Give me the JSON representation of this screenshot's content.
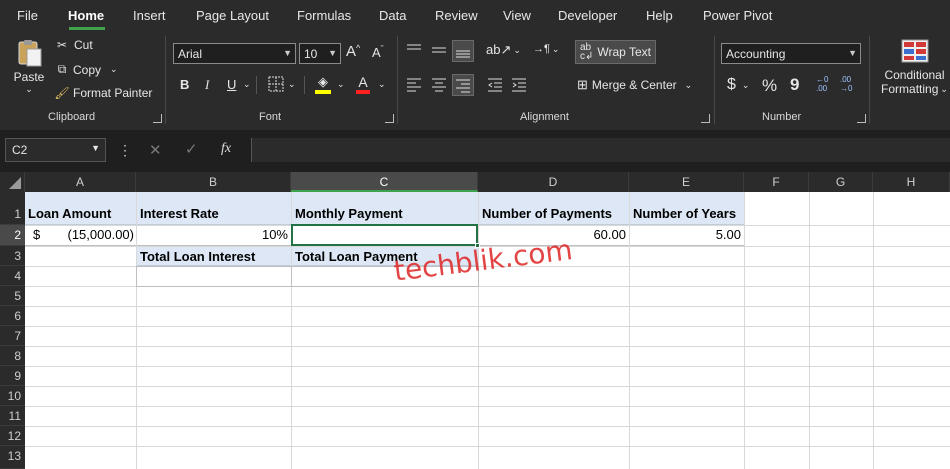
{
  "menu": {
    "tabs": [
      "File",
      "Home",
      "Insert",
      "Page Layout",
      "Formulas",
      "Data",
      "Review",
      "View",
      "Developer",
      "Help",
      "Power Pivot"
    ],
    "active": "Home"
  },
  "ribbon": {
    "clipboard": {
      "label": "Clipboard",
      "paste": "Paste",
      "cut": "Cut",
      "copy": "Copy",
      "format_painter": "Format Painter"
    },
    "font": {
      "label": "Font",
      "font_name": "Arial",
      "font_size": "10",
      "bold": "B",
      "italic": "I",
      "underline": "U",
      "grow": "A",
      "shrink": "A"
    },
    "alignment": {
      "label": "Alignment",
      "wrap_text": "Wrap Text",
      "merge_center": "Merge & Center"
    },
    "number": {
      "label": "Number",
      "format": "Accounting",
      "currency": "$",
      "percent": "%",
      "comma": "9"
    },
    "styles": {
      "conditional_1": "Conditional",
      "conditional_2": "Formatting"
    }
  },
  "formula_bar": {
    "name_box": "C2",
    "fx": "fx",
    "formula": ""
  },
  "sheet": {
    "columns": [
      "A",
      "B",
      "C",
      "D",
      "E",
      "F",
      "G",
      "H"
    ],
    "rows": [
      "1",
      "2",
      "3",
      "4",
      "5",
      "6",
      "7",
      "8",
      "9",
      "10",
      "11",
      "12",
      "13"
    ],
    "selected_column": "C",
    "selected_row": "2",
    "cells": {
      "A1": "Loan Amount",
      "B1": "Interest Rate",
      "C1": "Monthly Payment",
      "D1": "Number of Payments",
      "E1": "Number of Years",
      "A2_symbol": "$",
      "A2": "(15,000.00)",
      "B2": "10%",
      "C2": "",
      "D2": "60.00",
      "E2": "5.00",
      "B3": "Total Loan Interest",
      "C3": "Total Loan Payment",
      "B4": "",
      "C4": ""
    }
  },
  "watermark": "techblik.com",
  "colors": {
    "ribbon_bg": "#2b2b2b",
    "accent_green": "#217346",
    "header_fill": "#dde7f5"
  }
}
